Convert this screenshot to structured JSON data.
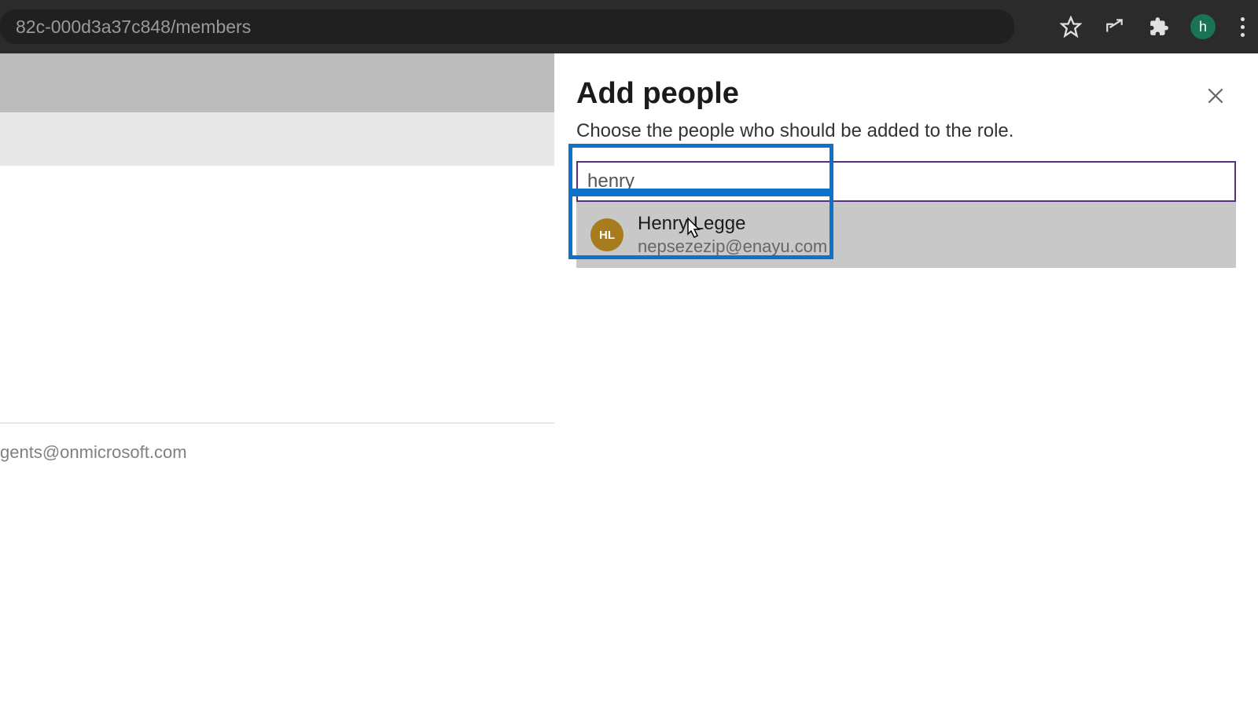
{
  "browser": {
    "url_fragment": "82c-000d3a37c848/members",
    "profile_initial": "h"
  },
  "background": {
    "email_fragment": "gents@onmicrosoft.com"
  },
  "panel": {
    "title": "Add people",
    "subtitle": "Choose the people who should be added to the role.",
    "search_value": "henry",
    "suggestion": {
      "initials": "HL",
      "name": "Henry Legge",
      "email": "nepsezezip@enayu.com"
    }
  }
}
